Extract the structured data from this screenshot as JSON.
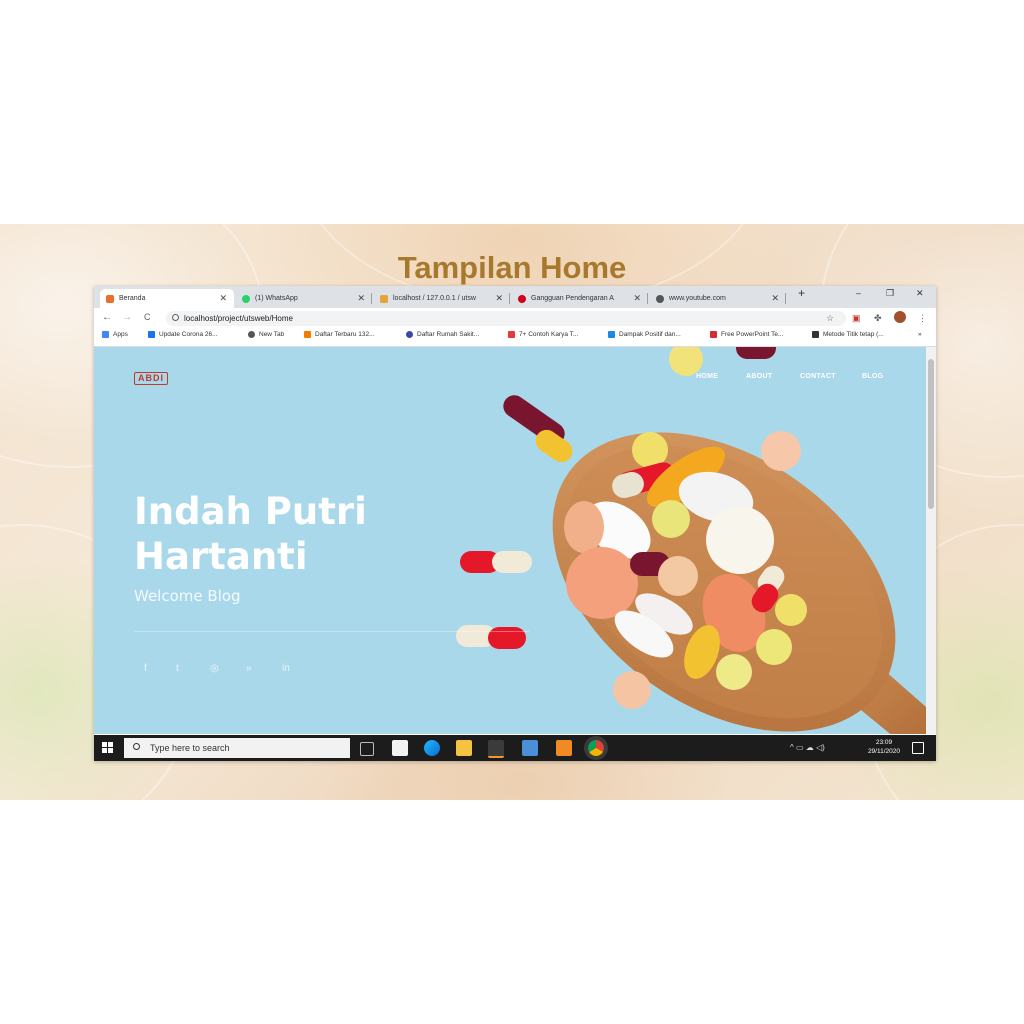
{
  "slide": {
    "title": "Tampilan Home"
  },
  "browser": {
    "tabs": [
      {
        "label": "Beranda",
        "active": true,
        "favicon_color": "#e8702a"
      },
      {
        "label": "(1) WhatsApp",
        "active": false,
        "favicon_color": "#25d366"
      },
      {
        "label": "localhost / 127.0.0.1 / utsw",
        "active": false,
        "favicon_color": "#e8a23a"
      },
      {
        "label": "Gangguan Pendengaran A",
        "active": false,
        "favicon_color": "#d0021b"
      },
      {
        "label": "www.youtube.com",
        "active": false,
        "favicon_color": "#555555"
      }
    ],
    "new_tab": "+",
    "window_controls": {
      "minimize": "–",
      "restore": "❐",
      "close": "✕"
    },
    "nav": {
      "back": "←",
      "forward": "→",
      "reload": "C"
    },
    "url": "localhost/project/utsweb/Home",
    "bookmarks": [
      {
        "label": "Apps",
        "color": "#4285f4"
      },
      {
        "label": "Update Corona 26...",
        "color": "#1a73e8"
      },
      {
        "label": "New Tab",
        "color": "#555555"
      },
      {
        "label": "Daftar Terbaru 132...",
        "color": "#f57c00"
      },
      {
        "label": "Daftar Rumah Sakit...",
        "color": "#3949ab"
      },
      {
        "label": "7+ Contoh Karya T...",
        "color": "#e53935"
      },
      {
        "label": "Dampak Positif dan...",
        "color": "#1e88e5"
      },
      {
        "label": "Free PowerPoint Te...",
        "color": "#d32f2f"
      },
      {
        "label": "Metode Titik tetap (...",
        "color": "#333333"
      }
    ],
    "bookmarks_more": "»"
  },
  "website": {
    "logo": "ABDI",
    "menu": [
      "HOME",
      "ABOUT",
      "CONTACT",
      "BLOG"
    ],
    "hero_name_line1": "Indah Putri",
    "hero_name_line2": "Hartanti",
    "hero_subtitle": "Welcome Blog",
    "social_icons": [
      "facebook-icon",
      "twitter-icon",
      "dribbble-icon",
      "rss-icon",
      "linkedin-icon"
    ],
    "social_glyphs": [
      "f",
      "t",
      "◎",
      "»",
      "in"
    ]
  },
  "taskbar": {
    "search_placeholder": "Type here to search",
    "time": "23:09",
    "date": "29/11/2020",
    "tray": "^ ▭ ☁ ◁)"
  },
  "colors": {
    "title": "#a7792f",
    "hero_bg": "#a9d8ea",
    "taskbar": "#1c1c1c"
  }
}
